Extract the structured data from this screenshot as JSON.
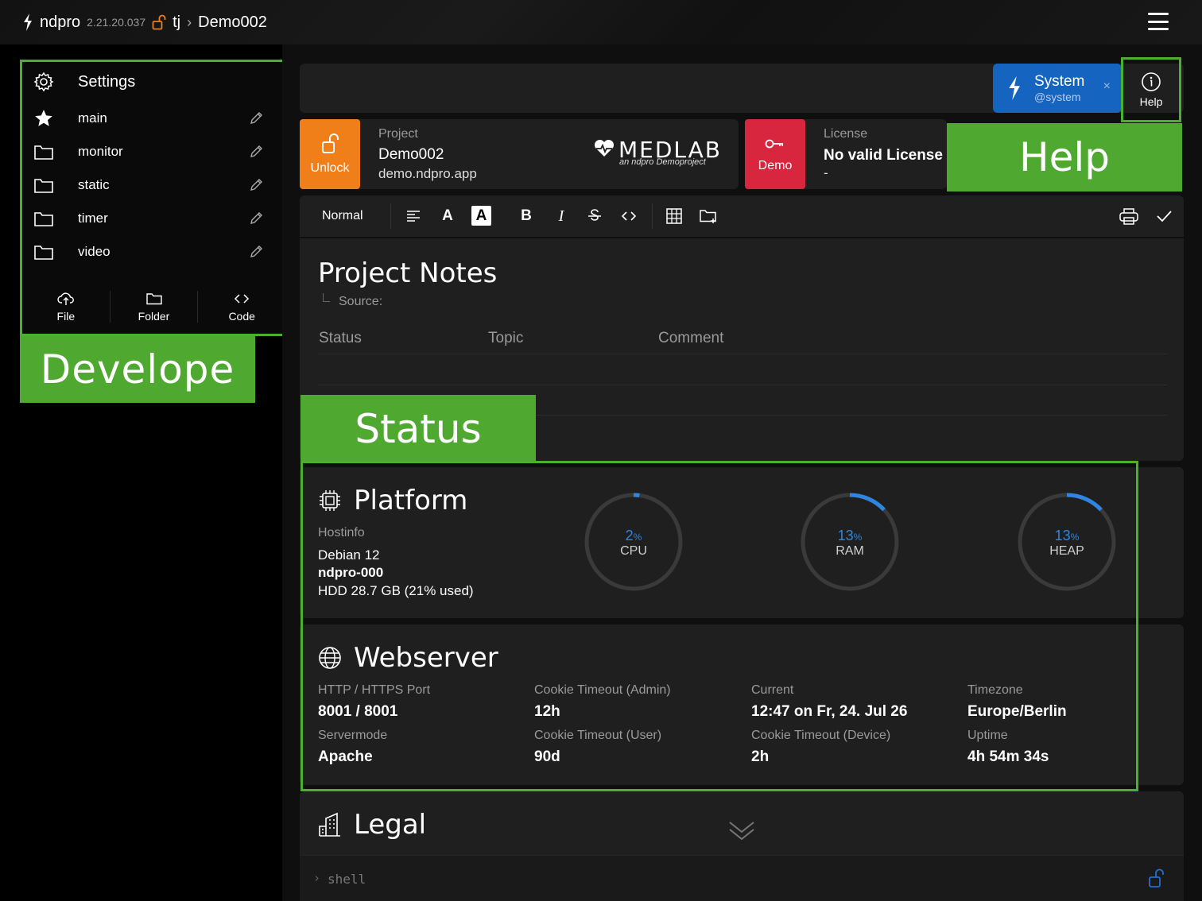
{
  "topbar": {
    "app_name": "ndpro",
    "version": "2.21.20.037",
    "user": "tj",
    "separator": "›",
    "project": "Demo002"
  },
  "sidebar": {
    "settings_label": "Settings",
    "items": [
      {
        "label": "main",
        "icon": "star-icon"
      },
      {
        "label": "monitor",
        "icon": "folder-icon"
      },
      {
        "label": "static",
        "icon": "folder-icon"
      },
      {
        "label": "timer",
        "icon": "folder-icon"
      },
      {
        "label": "video",
        "icon": "folder-icon"
      }
    ],
    "actions": [
      {
        "label": "File",
        "icon": "cloud-upload-icon"
      },
      {
        "label": "Folder",
        "icon": "folder-icon"
      },
      {
        "label": "Code",
        "icon": "code-icon"
      }
    ]
  },
  "annotations": {
    "develope": "Develope",
    "help": "Help",
    "status": "Status"
  },
  "system_chip": {
    "name": "System",
    "handle": "@system",
    "close": "×"
  },
  "help_button": {
    "label": "Help"
  },
  "project_card": {
    "unlock_label": "Unlock",
    "caption": "Project",
    "name": "Demo002",
    "domain": "demo.ndpro.app",
    "logo_title": "MEDLAB",
    "logo_subtitle": "an ndpro Demoproject"
  },
  "license_card": {
    "demo_label": "Demo",
    "caption": "License",
    "value": "No valid License",
    "sub": "-"
  },
  "editor_toolbar": {
    "format_select": "Normal"
  },
  "notes": {
    "title": "Project Notes",
    "source_label": "Source:",
    "columns": [
      "Status",
      "Topic",
      "Comment"
    ]
  },
  "platform": {
    "title": "Platform",
    "hostinfo_label": "Hostinfo",
    "os": "Debian 12",
    "hostname": "ndpro-000",
    "hdd": "HDD 28.7 GB (21% used)",
    "gauges": [
      {
        "value": "2",
        "unit": "%",
        "name": "CPU",
        "fraction": 0.02
      },
      {
        "value": "13",
        "unit": "%",
        "name": "RAM",
        "fraction": 0.13
      },
      {
        "value": "13",
        "unit": "%",
        "name": "HEAP",
        "fraction": 0.13
      }
    ]
  },
  "webserver": {
    "title": "Webserver",
    "fields": [
      {
        "label": "HTTP / HTTPS Port",
        "value": "8001 / 8001"
      },
      {
        "label": "Cookie Timeout (Admin)",
        "value": "12h"
      },
      {
        "label": "Current",
        "value": "12:47 on Fr, 24. Jul 26"
      },
      {
        "label": "Timezone",
        "value": "Europe/Berlin"
      },
      {
        "label": "Servermode",
        "value": "Apache"
      },
      {
        "label": "Cookie Timeout (User)",
        "value": "90d"
      },
      {
        "label": "Cookie Timeout (Device)",
        "value": "2h"
      },
      {
        "label": "Uptime",
        "value": "4h 54m 34s"
      }
    ]
  },
  "legal": {
    "title": "Legal"
  },
  "shell": {
    "prompt": "›",
    "placeholder": "shell"
  },
  "colors": {
    "accent_green": "#4fa830",
    "unlock_orange": "#f07f1a",
    "demo_red": "#d7263d",
    "system_blue": "#1565c0",
    "gauge_blue": "#2f86e0"
  }
}
